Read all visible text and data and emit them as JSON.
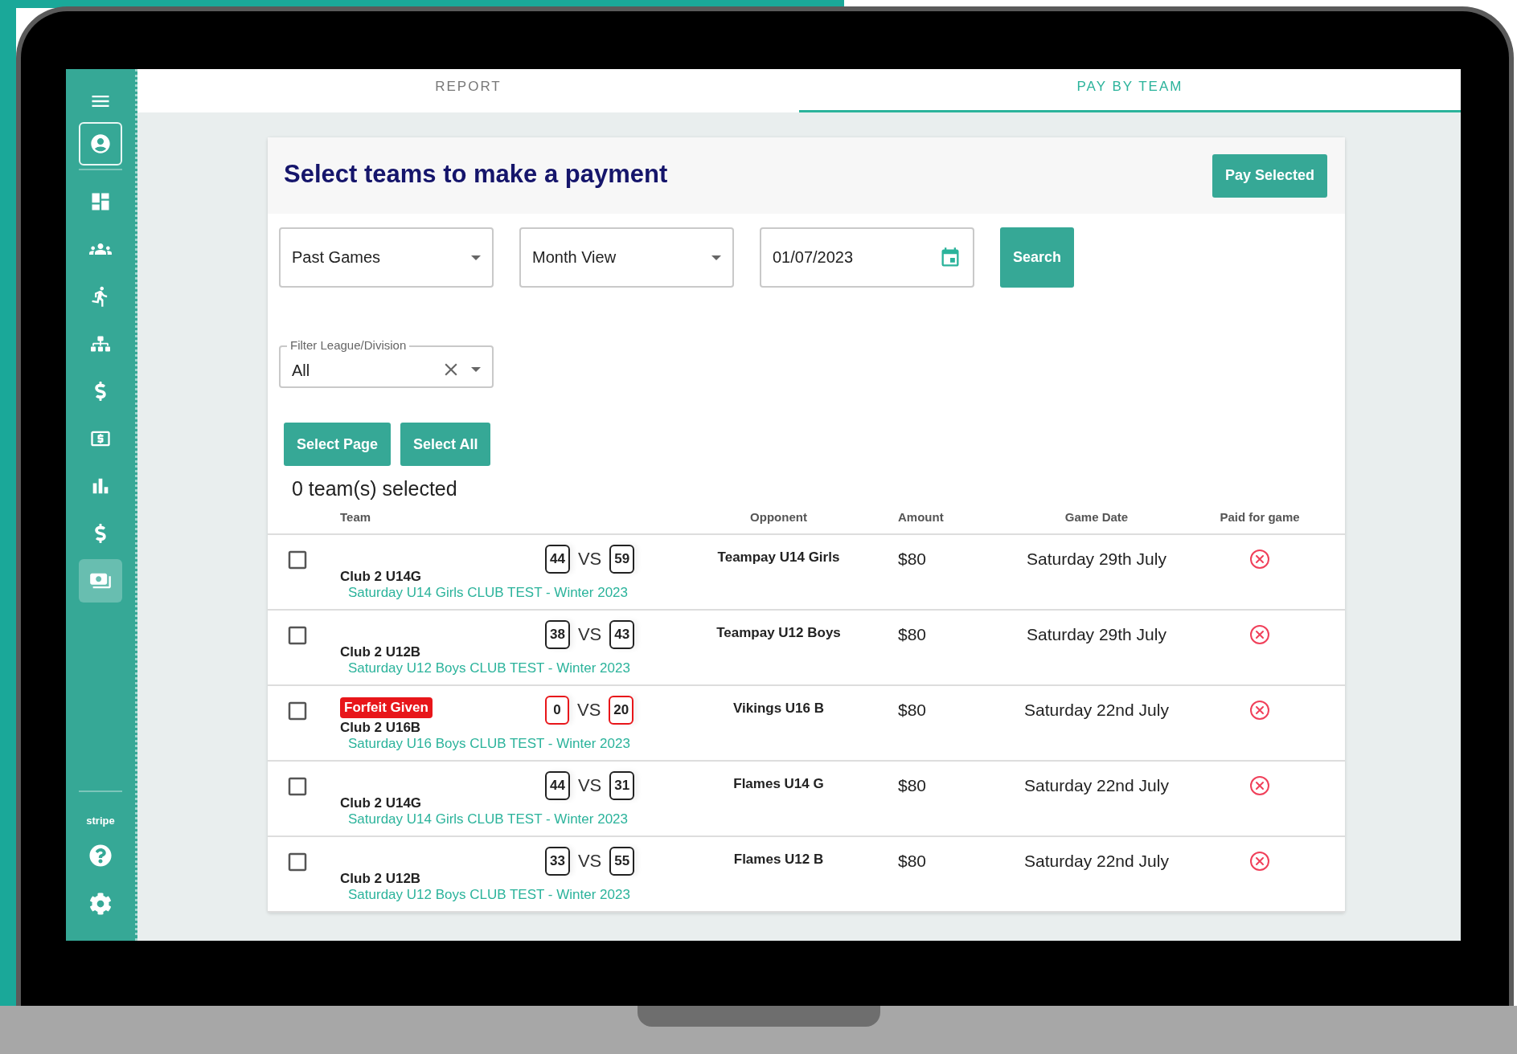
{
  "sidebar": {
    "nav": [
      {
        "selected": false
      },
      {
        "selected": false
      },
      {
        "selected": false
      },
      {
        "selected": false
      },
      {
        "selected": false
      },
      {
        "selected": false
      },
      {
        "selected": false
      },
      {
        "selected": false
      },
      {
        "selected": true
      }
    ],
    "brand": "stripe"
  },
  "tabs": [
    {
      "label": "REPORT",
      "selected": false
    },
    {
      "label": "PAY BY TEAM",
      "selected": true
    }
  ],
  "card": {
    "title": "Select teams to make a payment",
    "pay_button": "Pay Selected",
    "filters": {
      "game_type": "Past Games",
      "view": "Month View",
      "date": "01/07/2023",
      "search_button": "Search",
      "league_label": "Filter League/Division",
      "league_value": "All"
    },
    "select_buttons": [
      "Select Page",
      "Select All"
    ],
    "selected_count": "0 team(s) selected",
    "table": {
      "columns": [
        "Team",
        "Opponent",
        "Amount",
        "Game Date",
        "Paid for game"
      ],
      "rows": [
        {
          "checked": false,
          "team": "Club 2 U14G",
          "home_score": "44",
          "vs": "VS",
          "away_score": "59",
          "forfeit": false,
          "league": "Saturday U14 Girls CLUB TEST - Winter 2023",
          "opponent": "Teampay U14 Girls",
          "amount": "$80",
          "date": "Saturday 29th July",
          "paid": false
        },
        {
          "checked": false,
          "team": "Club 2 U12B",
          "home_score": "38",
          "vs": "VS",
          "away_score": "43",
          "forfeit": false,
          "league": "Saturday U12 Boys CLUB TEST - Winter 2023",
          "opponent": "Teampay U12 Boys",
          "amount": "$80",
          "date": "Saturday 29th July",
          "paid": false
        },
        {
          "checked": false,
          "badge": "Forfeit Given",
          "team": "Club 2 U16B",
          "home_score": "0",
          "vs": "VS",
          "away_score": "20",
          "forfeit": true,
          "league": "Saturday U16 Boys CLUB TEST - Winter 2023",
          "opponent": "Vikings U16 B",
          "amount": "$80",
          "date": "Saturday 22nd July",
          "paid": false
        },
        {
          "checked": false,
          "team": "Club 2 U14G",
          "home_score": "44",
          "vs": "VS",
          "away_score": "31",
          "forfeit": false,
          "league": "Saturday U14 Girls CLUB TEST - Winter 2023",
          "opponent": "Flames U14 G",
          "amount": "$80",
          "date": "Saturday 22nd July",
          "paid": false
        },
        {
          "checked": false,
          "team": "Club 2 U12B",
          "home_score": "33",
          "vs": "VS",
          "away_score": "55",
          "forfeit": false,
          "league": "Saturday U12 Boys CLUB TEST - Winter 2023",
          "opponent": "Flames U12 B",
          "amount": "$80",
          "date": "Saturday 22nd July",
          "paid": false
        }
      ]
    }
  }
}
